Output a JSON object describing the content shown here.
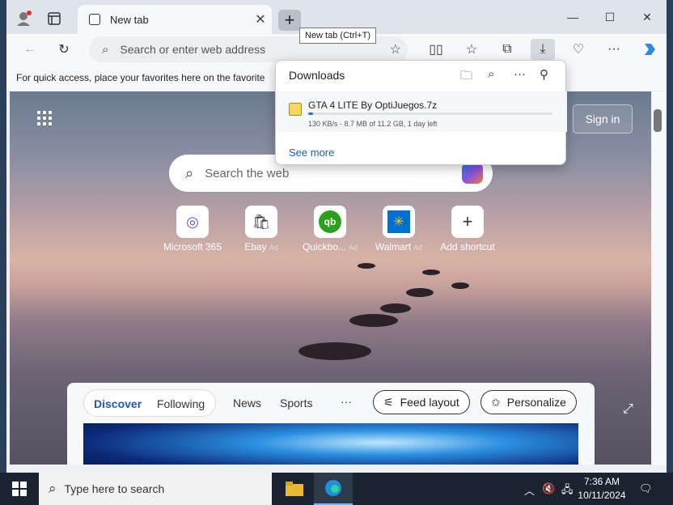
{
  "tab": {
    "title": "New tab",
    "close": "✕"
  },
  "newtab": {
    "symbol": "+",
    "tooltip": "New tab (Ctrl+T)"
  },
  "window": {
    "minimize": "—",
    "maximize": "☐",
    "close": "✕"
  },
  "address": {
    "placeholder": "Search or enter web address"
  },
  "favbar": {
    "text": "For quick access, place your favorites here on the favorite"
  },
  "downloads": {
    "title": "Downloads",
    "file_name": "GTA 4 LITE By OptiJuegos.7z",
    "meta": "130 KB/s - 8.7 MB of 11.2 GB, 1 day left",
    "progress": 0.008,
    "see_more": "See more"
  },
  "newtab_page": {
    "signin": "Sign in",
    "search_placeholder": "Search the web",
    "tiles": [
      {
        "label": "Microsoft 365",
        "ad": "",
        "icon": "◎"
      },
      {
        "label": "Ebay",
        "ad": "Ad",
        "icon": "🛍"
      },
      {
        "label": "Quickbo...",
        "ad": "Ad",
        "icon": "qb"
      },
      {
        "label": "Walmart",
        "ad": "Ad",
        "icon": "✳"
      },
      {
        "label": "Add shortcut",
        "ad": "",
        "icon": "+"
      }
    ]
  },
  "feed": {
    "tabs": [
      "Discover",
      "Following"
    ],
    "links": [
      "News",
      "Sports",
      "···"
    ],
    "feed_layout": "Feed layout",
    "personalize": "Personalize"
  },
  "taskbar": {
    "search_placeholder": "Type here to search",
    "time": "7:36 AM",
    "date": "10/11/2024"
  },
  "colors": {
    "accent": "#1a73e8",
    "discover": "#1d59c4"
  }
}
